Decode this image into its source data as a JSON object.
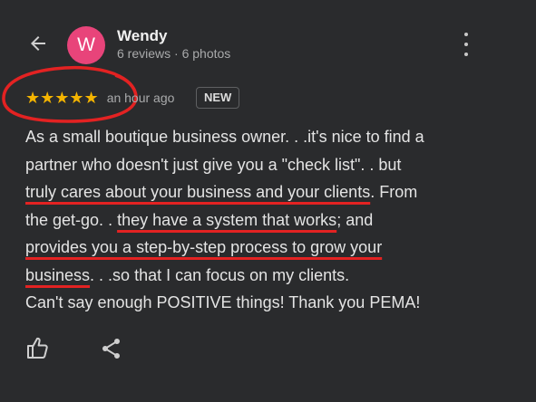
{
  "reviewer": {
    "initial": "W",
    "name": "Wendy",
    "meta": "6 reviews · 6 photos",
    "avatar_color": "#e8447a"
  },
  "review": {
    "stars": "★★★★★",
    "rating": 5,
    "time_ago": "an hour ago",
    "badge": "NEW",
    "lines": [
      {
        "a": "As a small boutique business owner. . .it's nice to find a"
      },
      {
        "a": "partner who doesn't just give you a \"check list\". . but"
      },
      {
        "u": "truly cares about your business and your clients",
        "b": ". From"
      },
      {
        "a": "the get-go. . ",
        "u": "they have a system that works",
        "b": "; and"
      },
      {
        "u": "provides you a step-by-step process to grow your"
      },
      {
        "u": "business",
        "b": ". . .so that I can focus on my clients."
      },
      {
        "a": "Can't say enough POSITIVE things! Thank you PEMA!"
      }
    ]
  },
  "icons": {
    "back": "back-arrow-icon",
    "more": "more-vert-icon",
    "like": "thumbs-up-icon",
    "share": "share-icon"
  },
  "colors": {
    "background": "#2a2b2d",
    "star": "#f4b400",
    "annotation": "#e32222"
  }
}
